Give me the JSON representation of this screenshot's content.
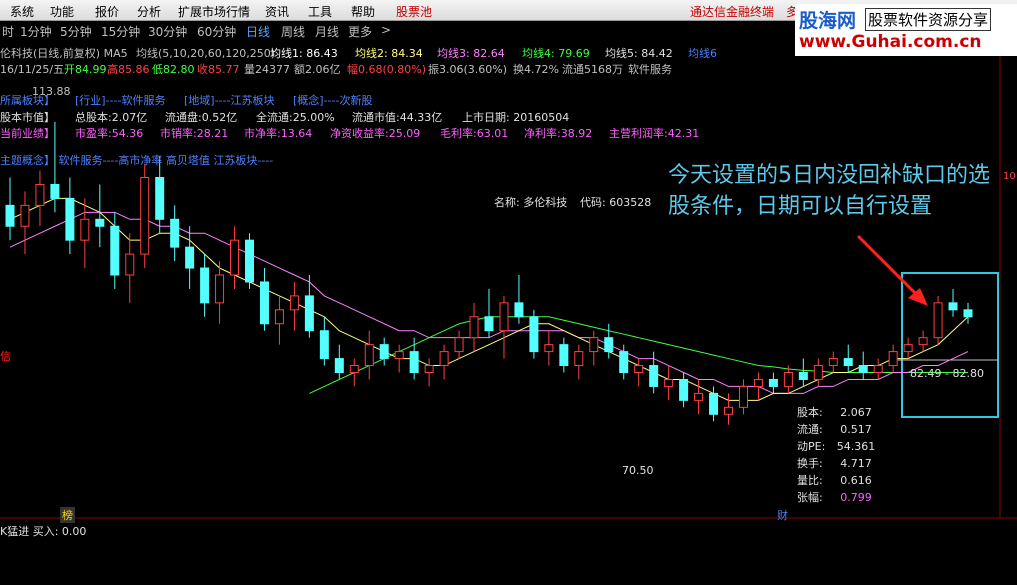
{
  "menu": {
    "items": [
      "系统",
      "功能",
      "报价",
      "分析",
      "扩展市场行情",
      "资讯",
      "工具",
      "帮助"
    ],
    "stock_pool": "股票池",
    "news_ticker": "通达信金融终端",
    "more": "多"
  },
  "logo": {
    "brand": "股海网",
    "slogan": "股票软件资源分享",
    "url": "www.Guhai.com.cn"
  },
  "periods": {
    "items": [
      "时",
      "1分钟",
      "5分钟",
      "15分钟",
      "30分钟",
      "60分钟",
      "日线",
      "周线",
      "月线",
      "更多"
    ],
    "active": "日线",
    "arrow": ">"
  },
  "header": {
    "title": "伦科技(日线,前复权) MA5",
    "ma_params": "均线(5,10,20,60,120,250)",
    "ma1": "均线1: 86.43",
    "ma2": "均线2: 84.34",
    "ma3": "均线3: 82.64",
    "ma4": "均线4: 79.69",
    "ma5": "均线5: 84.42",
    "ma6": "均线6",
    "date": "16/11/25/五",
    "open": "开84.99",
    "high": "高85.86",
    "low": "低82.80",
    "close": "收85.77",
    "volume": "量24377",
    "amount": "额2.06亿",
    "change": "幅0.68(0.80%)",
    "amplitude": "振3.06(3.60%)",
    "turnover": "换4.72%",
    "float": "流通5168万",
    "industry": "软件服务"
  },
  "info": {
    "line1": [
      "所属板块】",
      "[行业]----软件服务",
      "[地域]----江苏板块",
      "[概念]----次新股"
    ],
    "line2": [
      "股本市值】",
      "总股本:2.07亿",
      "流通盘:0.52亿",
      "全流通:25.00%",
      "流通市值:44.33亿",
      "上市日期: 20160504"
    ],
    "line3": [
      "当前业绩】",
      "市盈率:54.36",
      "市销率:28.21",
      "市净率:13.64",
      "净资收益率:25.09",
      "毛利率:63.01",
      "净利率:38.92",
      "主营利润率:42.31"
    ],
    "line4": "主题概念】  软件服务----高市净率 高贝塔值 江苏板块----"
  },
  "stock": {
    "name": "名称: 多伦科技",
    "code": "代码: 603528"
  },
  "annotation": "今天设置的5日内没回补缺口的选股条件，日期可以自行设置",
  "labels": {
    "high": "113.88",
    "low": "70.50",
    "gap": "82.49 - 82.80",
    "left_red": "信",
    "axis_right": "10",
    "badge_left": "榜",
    "badge_cai": "财"
  },
  "quote_panel": [
    {
      "k": "股本:",
      "v": "2.067"
    },
    {
      "k": "流通:",
      "v": "0.517"
    },
    {
      "k": "动PE:",
      "v": "54.361"
    },
    {
      "k": "换手:",
      "v": "4.717"
    },
    {
      "k": "量比:",
      "v": "0.616"
    },
    {
      "k": "张幅:",
      "v": "0.799"
    }
  ],
  "bottom": {
    "text": "K猛进 买入: 0.00"
  },
  "colors": {
    "up": "#ff4040",
    "down": "#54ffff",
    "ma5": "#ffffff",
    "ma10": "#ffff80",
    "ma20": "#ff80ff",
    "ma60": "#40ff40",
    "highlight": "#4da6ff"
  },
  "chart_data": {
    "type": "candlestick",
    "ylim": [
      64,
      120
    ],
    "high_label": 113.88,
    "low_label": 70.5,
    "ohlc": [
      [
        102,
        106,
        97,
        99
      ],
      [
        99,
        104,
        95,
        102
      ],
      [
        102,
        107,
        99,
        105
      ],
      [
        105,
        114,
        101,
        103
      ],
      [
        103,
        106,
        95,
        97
      ],
      [
        97,
        103,
        93,
        100
      ],
      [
        100,
        105,
        96,
        99
      ],
      [
        99,
        101,
        90,
        92
      ],
      [
        92,
        98,
        88,
        95
      ],
      [
        95,
        108,
        93,
        106
      ],
      [
        106,
        109,
        98,
        100
      ],
      [
        100,
        102,
        94,
        96
      ],
      [
        96,
        99,
        90,
        93
      ],
      [
        93,
        95,
        86,
        88
      ],
      [
        88,
        94,
        85,
        92
      ],
      [
        92,
        99,
        90,
        97
      ],
      [
        97,
        98,
        90,
        91
      ],
      [
        91,
        93,
        84,
        85
      ],
      [
        85,
        89,
        82,
        87
      ],
      [
        87,
        91,
        84,
        89
      ],
      [
        89,
        92,
        83,
        84
      ],
      [
        84,
        86,
        79,
        80
      ],
      [
        80,
        82,
        77,
        78
      ],
      [
        78,
        80,
        76,
        79
      ],
      [
        79,
        84,
        77,
        82
      ],
      [
        82,
        83,
        79,
        80
      ],
      [
        80,
        82,
        78,
        81
      ],
      [
        81,
        83,
        77,
        78
      ],
      [
        78,
        80,
        76,
        79
      ],
      [
        79,
        82,
        77,
        81
      ],
      [
        81,
        84,
        80,
        83
      ],
      [
        83,
        88,
        81,
        86
      ],
      [
        86,
        90,
        83,
        84
      ],
      [
        84,
        89,
        80,
        88
      ],
      [
        88,
        92,
        85,
        86
      ],
      [
        86,
        87,
        80,
        81
      ],
      [
        81,
        84,
        79,
        82
      ],
      [
        82,
        83,
        78,
        79
      ],
      [
        79,
        82,
        77,
        81
      ],
      [
        81,
        84,
        79,
        83
      ],
      [
        83,
        85,
        80,
        81
      ],
      [
        81,
        82,
        77,
        78
      ],
      [
        78,
        80,
        76,
        79
      ],
      [
        79,
        81,
        75,
        76
      ],
      [
        76,
        79,
        74,
        77
      ],
      [
        77,
        78,
        73,
        74
      ],
      [
        74,
        77,
        72,
        75
      ],
      [
        75,
        76,
        71,
        72
      ],
      [
        72,
        75,
        70.5,
        73
      ],
      [
        73,
        77,
        72,
        76
      ],
      [
        76,
        78,
        74,
        77
      ],
      [
        77,
        78,
        75,
        76
      ],
      [
        76,
        79,
        75,
        78
      ],
      [
        78,
        80,
        76,
        77
      ],
      [
        77,
        80,
        76,
        79
      ],
      [
        79,
        81,
        78,
        80
      ],
      [
        80,
        82,
        78,
        79
      ],
      [
        79,
        81,
        77,
        78
      ],
      [
        78,
        80,
        77,
        79
      ],
      [
        79,
        82,
        78,
        81
      ],
      [
        81,
        83,
        80,
        82
      ],
      [
        82,
        84,
        81,
        83
      ],
      [
        83,
        89,
        82,
        88
      ],
      [
        88,
        90,
        86,
        87
      ],
      [
        87,
        88,
        85,
        86
      ]
    ],
    "ma5": [
      100,
      101,
      102,
      103,
      103,
      102,
      101,
      99,
      97,
      97,
      98,
      98,
      97,
      95,
      93,
      92,
      91,
      90,
      89,
      88,
      87,
      86,
      84,
      83,
      82,
      81,
      80,
      80,
      79,
      79,
      80,
      81,
      82,
      83,
      84,
      85,
      85,
      84,
      83,
      82,
      81,
      80,
      79,
      78,
      77,
      77,
      76,
      75,
      74,
      74,
      74,
      75,
      75,
      76,
      77,
      78,
      78,
      79,
      79,
      80,
      80,
      81,
      82,
      84,
      86
    ],
    "ma20": [
      96,
      97,
      98,
      99,
      100,
      101,
      101,
      101,
      100,
      100,
      99,
      99,
      98,
      98,
      97,
      96,
      95,
      94,
      93,
      92,
      91,
      89,
      88,
      87,
      86,
      85,
      84,
      84,
      83,
      83,
      83,
      83,
      83,
      84,
      84,
      84,
      84,
      84,
      83,
      83,
      82,
      81,
      80,
      80,
      79,
      78,
      77,
      77,
      76,
      76,
      76,
      75,
      75,
      75,
      76,
      76,
      77,
      77,
      77,
      78,
      78,
      79,
      79,
      80,
      81
    ],
    "ma60": [
      null,
      null,
      null,
      null,
      null,
      null,
      null,
      null,
      null,
      null,
      null,
      null,
      null,
      null,
      null,
      null,
      null,
      null,
      null,
      null,
      75,
      76,
      77,
      78,
      79,
      80,
      81,
      82,
      83,
      84,
      85,
      85.5,
      86,
      86,
      86,
      86,
      86,
      85.5,
      85,
      84.5,
      84,
      83.5,
      83,
      82.5,
      82,
      81.5,
      81,
      80.5,
      80,
      79.5,
      79,
      78.8,
      78.5,
      78.3,
      78.2,
      78,
      78,
      78,
      78,
      78,
      78,
      78,
      78,
      78,
      78
    ]
  }
}
